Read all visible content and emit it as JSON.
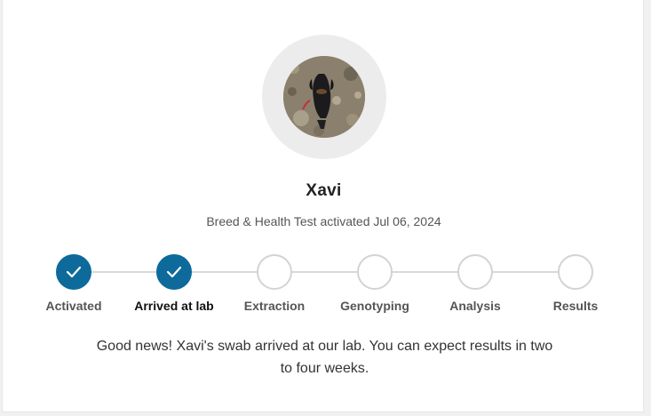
{
  "dog": {
    "name": "Xavi",
    "photo_icon": "dog-photo",
    "subtitle": "Breed & Health Test activated Jul 06, 2024"
  },
  "steps": [
    {
      "label": "Activated",
      "complete": true
    },
    {
      "label": "Arrived at lab",
      "complete": true
    },
    {
      "label": "Extraction",
      "complete": false
    },
    {
      "label": "Genotyping",
      "complete": false
    },
    {
      "label": "Analysis",
      "complete": false
    },
    {
      "label": "Results",
      "complete": false
    }
  ],
  "progress": {
    "completed_steps": 2,
    "total_steps": 6
  },
  "message": "Good news! Xavi's swab arrived at our lab. You can expect results in two to four weeks.",
  "colors": {
    "accent": "#0d6a9b",
    "pending_border": "#d3d3d3",
    "track": "#d9d9d9",
    "ring": "#ececec"
  }
}
